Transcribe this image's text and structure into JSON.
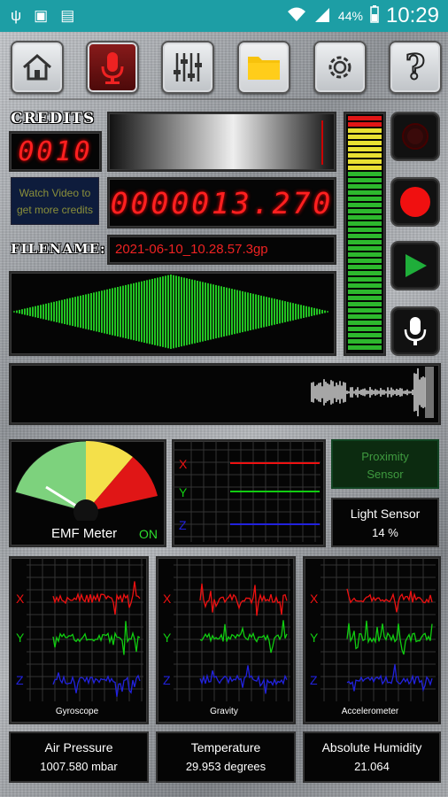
{
  "status_bar": {
    "battery_percent": "44%",
    "time": "10:29"
  },
  "toolbar": {
    "home_icon": "home-icon",
    "mic_icon": "microphone-icon",
    "mixer_icon": "sliders-icon",
    "folder_icon": "folder-icon",
    "settings_icon": "gear-icon",
    "help_icon": "help-icon"
  },
  "recorder": {
    "credits_label": "CREDITS",
    "credits_value": "0010",
    "watch_video_label": "Watch Video to get more credits",
    "counter": "0000013.270",
    "filename_label": "FILENAME:",
    "filename_value": "2021-06-10_10.28.57.3gp"
  },
  "sensors": {
    "proximity_label": "Proximity Sensor",
    "light_label": "Light Sensor",
    "light_value": "14 %",
    "emf_label": "EMF Meter",
    "emf_status": "ON",
    "axis_x": "X",
    "axis_y": "Y",
    "axis_z": "Z",
    "gyroscope_label": "Gyroscope",
    "gravity_label": "Gravity",
    "accelerometer_label": "Accelerometer",
    "air_pressure_label": "Air Pressure",
    "air_pressure_value": "1007.580 mbar",
    "temperature_label": "Temperature",
    "temperature_value": "29.953 degrees",
    "humidity_label": "Absolute Humidity",
    "humidity_value": "21.064"
  },
  "colors": {
    "red": "#e11",
    "green": "#1c1",
    "blue": "#22d",
    "statusbar": "#1d9ea5"
  }
}
